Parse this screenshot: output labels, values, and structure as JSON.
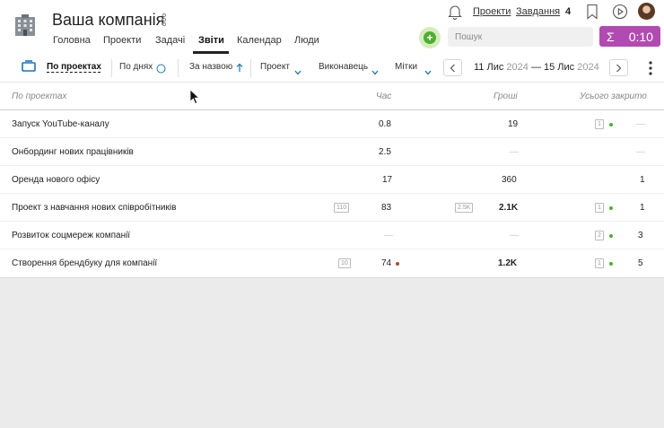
{
  "header": {
    "company": "Ваша компанія",
    "nav": [
      "Головна",
      "Проекти",
      "Задачі",
      "Звіти",
      "Календар",
      "Люди"
    ],
    "active_nav": "Звіти",
    "links": {
      "projects": "Проекти",
      "tasks": "Завдання",
      "tasks_count": "4"
    },
    "search_placeholder": "Пошук",
    "timer": {
      "sigma": "Σ",
      "time": "0:10"
    }
  },
  "toolbar": {
    "group_by": "По проектах",
    "by_days": "По днях",
    "sort": "За назвою",
    "filter_project": "Проект",
    "filter_assignee": "Виконавець",
    "filter_tags": "Мітки",
    "date_from": "11 Лис",
    "year_from": "2024",
    "date_dash": "—",
    "date_to": "15 Лис",
    "year_to": "2024"
  },
  "table": {
    "headers": {
      "name": "По проектах",
      "time": "Час",
      "money": "Гроші",
      "closed": "Усього закрито"
    },
    "rows": [
      {
        "name": "Запуск YouTube-каналу",
        "time_badge": "",
        "time": "0.8",
        "money_badge": "",
        "money": "19",
        "money_bold": false,
        "closed_badge": "1",
        "closed": "—"
      },
      {
        "name": "Онбординг нових працівників",
        "time_badge": "",
        "time": "2.5",
        "money_badge": "",
        "money": "—",
        "money_bold": false,
        "closed_badge": "",
        "closed": "—"
      },
      {
        "name": "Оренда нового офісу",
        "time_badge": "",
        "time": "17",
        "money_badge": "",
        "money": "360",
        "money_bold": false,
        "closed_badge": "",
        "closed": "1"
      },
      {
        "name": "Проект з навчання нових співробітників",
        "time_badge": "110",
        "time": "83",
        "money_badge": "2.5K",
        "money": "2.1K",
        "money_bold": true,
        "closed_badge": "1",
        "closed": "1"
      },
      {
        "name": "Розвиток соцмереж компанії",
        "time_badge": "",
        "time": "—",
        "money_badge": "",
        "money": "—",
        "money_bold": false,
        "closed_badge": "2",
        "closed": "3"
      },
      {
        "name": "Створення брендбуку для компанії",
        "time_badge": "10",
        "time": "74",
        "money_badge": "",
        "money": "1.2K",
        "money_bold": true,
        "closed_badge": "1",
        "closed": "5"
      }
    ]
  },
  "colors": {
    "accent_purple": "#b24bb1",
    "green": "#4caf2e",
    "brown_dot": "#a0522d",
    "timeline_blue": "#1a73b8"
  }
}
